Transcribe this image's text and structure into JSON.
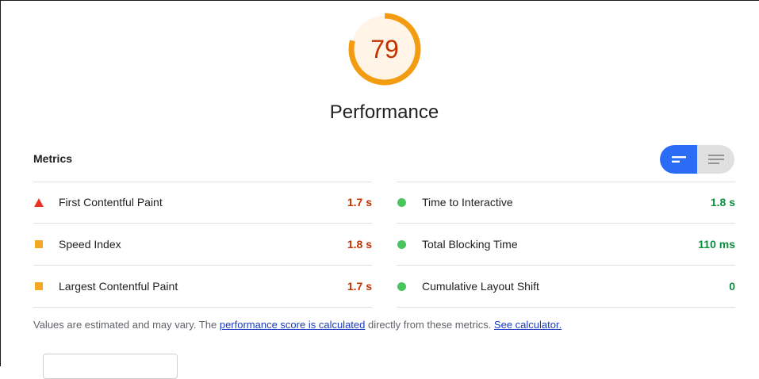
{
  "score": {
    "value": "79",
    "fraction": 0.79,
    "title": "Performance"
  },
  "colors": {
    "average_ring": "#f39c12",
    "average_fill": "#fff4e5",
    "fail": "#eb3324",
    "average": "#f5a623",
    "pass": "#48c55c",
    "toggle_active": "#2a6cf6",
    "link": "#1a3ac2"
  },
  "metrics": {
    "header": "Metrics",
    "left": [
      {
        "label": "First Contentful Paint",
        "value": "1.7 s",
        "indicator": "fail-triangle-icon"
      },
      {
        "label": "Speed Index",
        "value": "1.8 s",
        "indicator": "average-square-icon"
      },
      {
        "label": "Largest Contentful Paint",
        "value": "1.7 s",
        "indicator": "average-square-icon"
      }
    ],
    "right": [
      {
        "label": "Time to Interactive",
        "value": "1.8 s",
        "indicator": "pass-circle-icon"
      },
      {
        "label": "Total Blocking Time",
        "value": "110 ms",
        "indicator": "pass-circle-icon"
      },
      {
        "label": "Cumulative Layout Shift",
        "value": "0",
        "indicator": "pass-circle-icon"
      }
    ]
  },
  "toggle": {
    "left_icon": "compact-view-icon",
    "right_icon": "expanded-view-icon"
  },
  "note": {
    "prefix": "Values are estimated and may vary. The ",
    "link1": "performance score is calculated",
    "middle": " directly from these metrics. ",
    "link2": "See calculator."
  }
}
